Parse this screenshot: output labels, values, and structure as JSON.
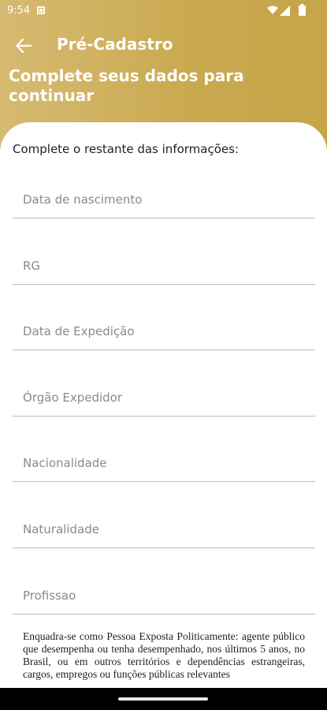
{
  "status_bar": {
    "time": "9:54",
    "icons": [
      "notification-icon",
      "wifi-icon",
      "signal-icon",
      "battery-icon"
    ]
  },
  "app_bar": {
    "back_icon": "arrow-left-icon",
    "title": "Pré-Cadastro"
  },
  "header": {
    "subtitle": "Complete seus dados para continuar"
  },
  "form": {
    "section_title": "Complete o restante das informações:",
    "fields": [
      {
        "placeholder": "Data de nascimento",
        "value": ""
      },
      {
        "placeholder": "RG",
        "value": ""
      },
      {
        "placeholder": "Data de Expedição",
        "value": ""
      },
      {
        "placeholder": "Órgão Expedidor",
        "value": ""
      },
      {
        "placeholder": "Nacionalidade",
        "value": ""
      },
      {
        "placeholder": "Naturalidade",
        "value": ""
      },
      {
        "placeholder": "Profissao",
        "value": ""
      }
    ],
    "pep_text": "Enquadra-se como Pessoa Exposta Politicamente: agente público que desempenha ou tenha desempenhado, nos últimos 5 anos, no Brasil, ou em outros territórios e dependências estrangeiras, cargos, empregos ou funções públicas relevantes"
  },
  "colors": {
    "header_gold": "#c9a94f",
    "header_gold_light": "#d6ba71",
    "divider": "#bdbdbd"
  }
}
